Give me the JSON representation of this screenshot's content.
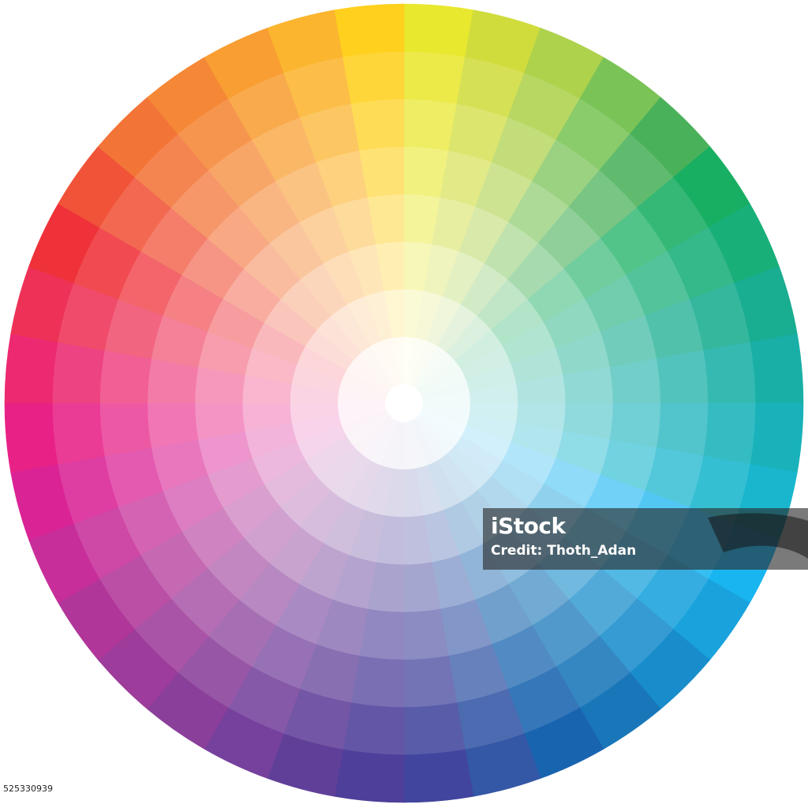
{
  "wheel": {
    "segments": 36,
    "rings": 8,
    "hues_clockwise_from_top": [
      "#e6e519",
      "#cbd827",
      "#a5cd39",
      "#6cbd45",
      "#37a949",
      "#00a651",
      "#00a66b",
      "#00a485",
      "#00a79d",
      "#00aab3",
      "#00aec8",
      "#00adef",
      "#0098d8",
      "#0081c6",
      "#0068b2",
      "#0054a6",
      "#1e459c",
      "#2e3192",
      "#3b2a8f",
      "#4f2a8e",
      "#662d91",
      "#7d2a8f",
      "#92278f",
      "#a8218e",
      "#c1188f",
      "#d60b8a",
      "#e5097a",
      "#ea1262",
      "#ec1c45",
      "#ed1c24",
      "#ef4123",
      "#f26522",
      "#f47b20",
      "#f7941d",
      "#fbad18",
      "#ffcb05"
    ],
    "center_color": "#ffffff"
  },
  "watermark": {
    "logo": "iStock",
    "credit": "Credit: Thoth_Adan"
  },
  "image_id": "525330939"
}
